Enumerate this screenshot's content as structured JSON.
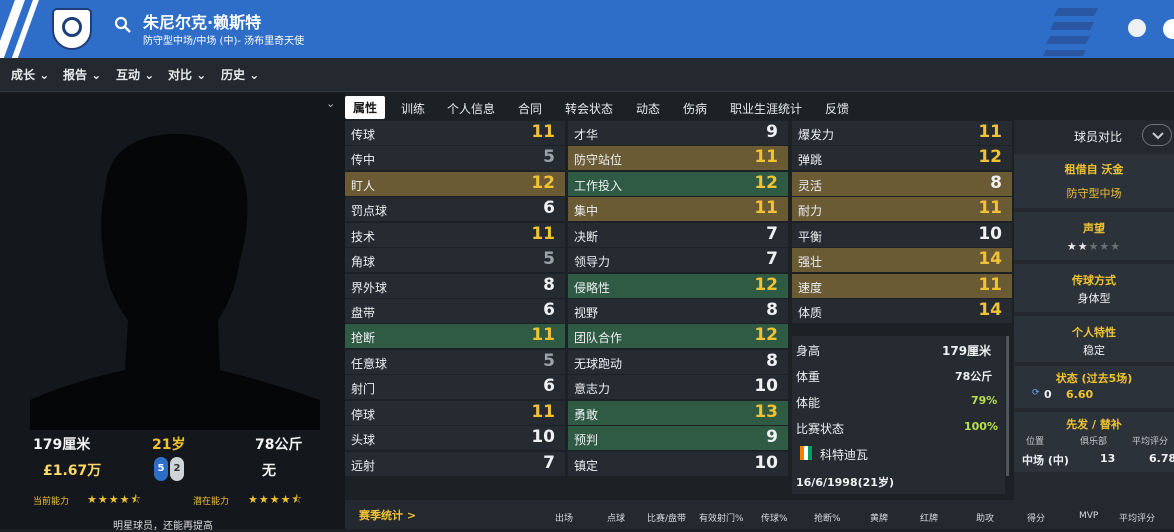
{
  "header": {
    "player_name": "朱尼尔克·赖斯特",
    "subtitle": "防守型中场/中场 (中)- 汤布里奇天使",
    "colors": {
      "brand_blue": "#2e6ec9",
      "accent_gold": "#f1c232"
    }
  },
  "nav": [
    "成长",
    "报告",
    "互动",
    "对比",
    "历史"
  ],
  "tabs": [
    "属性",
    "训练",
    "个人信息",
    "合同",
    "转会状态",
    "动态",
    "伤病",
    "职业生涯统计",
    "反馈"
  ],
  "bio": {
    "height": "179厘米",
    "age": "21岁",
    "weight": "78公斤",
    "value": "£1.67万",
    "right_foot": "5",
    "left_foot": "2",
    "release_clause": "无",
    "current_ability_label": "当前能力",
    "potential_ability_label": "潜在能力",
    "current_ability_stars": 4.5,
    "potential_ability_stars": 4.5,
    "scout_note": "明星球员，还能再提高"
  },
  "attributes": {
    "col1": [
      {
        "name": "传球",
        "value": "11"
      },
      {
        "name": "传中",
        "value": "5"
      },
      {
        "name": "盯人",
        "value": "12"
      },
      {
        "name": "罚点球",
        "value": "6"
      },
      {
        "name": "技术",
        "value": "11"
      },
      {
        "name": "角球",
        "value": "5"
      },
      {
        "name": "界外球",
        "value": "8"
      },
      {
        "name": "盘带",
        "value": "6"
      },
      {
        "name": "抢断",
        "value": "11"
      },
      {
        "name": "任意球",
        "value": "5"
      },
      {
        "name": "射门",
        "value": "6"
      },
      {
        "name": "停球",
        "value": "11"
      },
      {
        "name": "头球",
        "value": "10"
      },
      {
        "name": "远射",
        "value": "7"
      }
    ],
    "col2": [
      {
        "name": "才华",
        "value": "9"
      },
      {
        "name": "防守站位",
        "value": "11"
      },
      {
        "name": "工作投入",
        "value": "12"
      },
      {
        "name": "集中",
        "value": "11"
      },
      {
        "name": "决断",
        "value": "7"
      },
      {
        "name": "领导力",
        "value": "7"
      },
      {
        "name": "侵略性",
        "value": "12"
      },
      {
        "name": "视野",
        "value": "8"
      },
      {
        "name": "团队合作",
        "value": "12"
      },
      {
        "name": "无球跑动",
        "value": "8"
      },
      {
        "name": "意志力",
        "value": "10"
      },
      {
        "name": "勇敢",
        "value": "13"
      },
      {
        "name": "预判",
        "value": "9"
      },
      {
        "name": "镇定",
        "value": "10"
      }
    ],
    "col3": [
      {
        "name": "爆发力",
        "value": "11"
      },
      {
        "name": "弹跳",
        "value": "12"
      },
      {
        "name": "灵活",
        "value": "8"
      },
      {
        "name": "耐力",
        "value": "11"
      },
      {
        "name": "平衡",
        "value": "10"
      },
      {
        "name": "强壮",
        "value": "14"
      },
      {
        "name": "速度",
        "value": "11"
      },
      {
        "name": "体质",
        "value": "14"
      }
    ]
  },
  "physical": {
    "height_label": "身高",
    "height": "179厘米",
    "weight_label": "体重",
    "weight": "78公斤",
    "fitness_label": "体能",
    "fitness": "79%",
    "match_label": "比赛状态",
    "match": "100%",
    "nationality": "科特迪瓦",
    "dob": "16/6/1998(21岁)"
  },
  "right_panel": {
    "compare_label": "球员对比",
    "loan": "租借自 沃金",
    "role": "防守型中场",
    "reputation_title": "声望",
    "reputation_stars": 2,
    "style_title": "传球方式",
    "style_value": "身体型",
    "trait_title": "个人特性",
    "trait_value": "稳定",
    "form_title": "状态 (过去5场)",
    "form_games": "0",
    "form_rating": "6.60",
    "position_title": "先发 / 替补",
    "pos_head": "位置",
    "club_head": "俱乐部",
    "avg_head": "平均评分",
    "pos_value": "中场 (中)",
    "club_value": "13",
    "avg_value": "6.78"
  },
  "stats_bar": {
    "link": "赛季统计 >",
    "headers": [
      "出场",
      "点球",
      "比赛/盘带",
      "有效射门%",
      "传球%",
      "抢断%",
      "黄牌",
      "红牌",
      "助攻",
      "得分",
      "MVP",
      "平均评分"
    ]
  }
}
